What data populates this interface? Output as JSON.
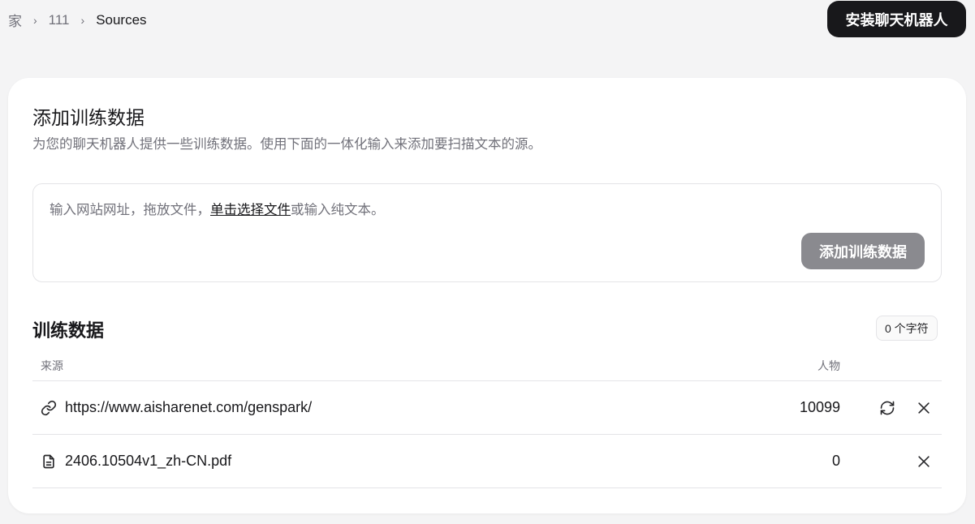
{
  "breadcrumb": {
    "home": "家",
    "project": "111",
    "current": "Sources"
  },
  "header": {
    "install_button": "安装聊天机器人"
  },
  "card": {
    "title": "添加训练数据",
    "description": "为您的聊天机器人提供一些训练数据。使用下面的一体化输入来添加要扫描文本的源。",
    "input": {
      "placeholder_before": "输入网站网址，拖放文件，",
      "placeholder_link": "单击选择文件",
      "placeholder_after": "或输入纯文本。",
      "add_button": "添加训练数据"
    }
  },
  "training": {
    "title": "训练数据",
    "char_count": "0 个字符",
    "columns": {
      "source": "来源",
      "characters": "人物"
    },
    "rows": [
      {
        "type": "link-icon",
        "name": "https://www.aisharenet.com/genspark/",
        "count": "10099"
      },
      {
        "type": "file-icon",
        "name": "2406.10504v1_zh-CN.pdf",
        "count": "0"
      }
    ]
  }
}
